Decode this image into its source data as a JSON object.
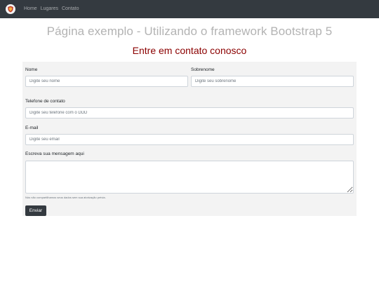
{
  "navbar": {
    "brand_icon": "shield-logo-icon",
    "links": [
      "Home",
      "Lugares",
      "Contato"
    ],
    "background": "#343a40"
  },
  "page": {
    "title": "Página exemplo - Utilizando o framework Bootstrap 5",
    "contact_heading": "Entre em contato conosco"
  },
  "form": {
    "first_name": {
      "label": "Nome",
      "placeholder": "Digite seu nome"
    },
    "last_name": {
      "label": "Sobrenome",
      "placeholder": "Digite seu sobrenome"
    },
    "phone": {
      "label": "Telefone de contato",
      "placeholder": "Digite seu telefone com o DDD"
    },
    "email": {
      "label": "E-mail",
      "placeholder": "Digite seu email"
    },
    "message": {
      "label": "Escreva sua mensagem aqui",
      "placeholder": ""
    },
    "help_text": "Nós não compartilhamos seus dados sem sua atorização prévia.",
    "submit_label": "Enviar"
  },
  "colors": {
    "heading_muted": "#b3b3b3",
    "contact_heading": "#8b0000",
    "panel_bg": "#f3f3f3",
    "button_bg": "#343a40"
  }
}
